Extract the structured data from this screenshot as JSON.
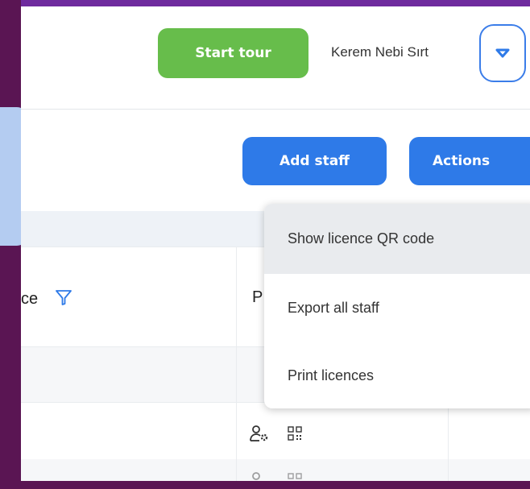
{
  "header": {
    "start_tour_label": "Start tour",
    "user_name": "Kerem Nebi Sırt"
  },
  "toolbar": {
    "add_staff_label": "Add staff",
    "actions_label": "Actions"
  },
  "table": {
    "columns": [
      "ce",
      "P"
    ]
  },
  "actions_menu": {
    "items": [
      "Show licence QR code",
      "Export all staff",
      "Print licences"
    ]
  },
  "colors": {
    "primary": "#2e7ae8",
    "tour": "#67bd4b",
    "sidebar": "#5a1553"
  }
}
